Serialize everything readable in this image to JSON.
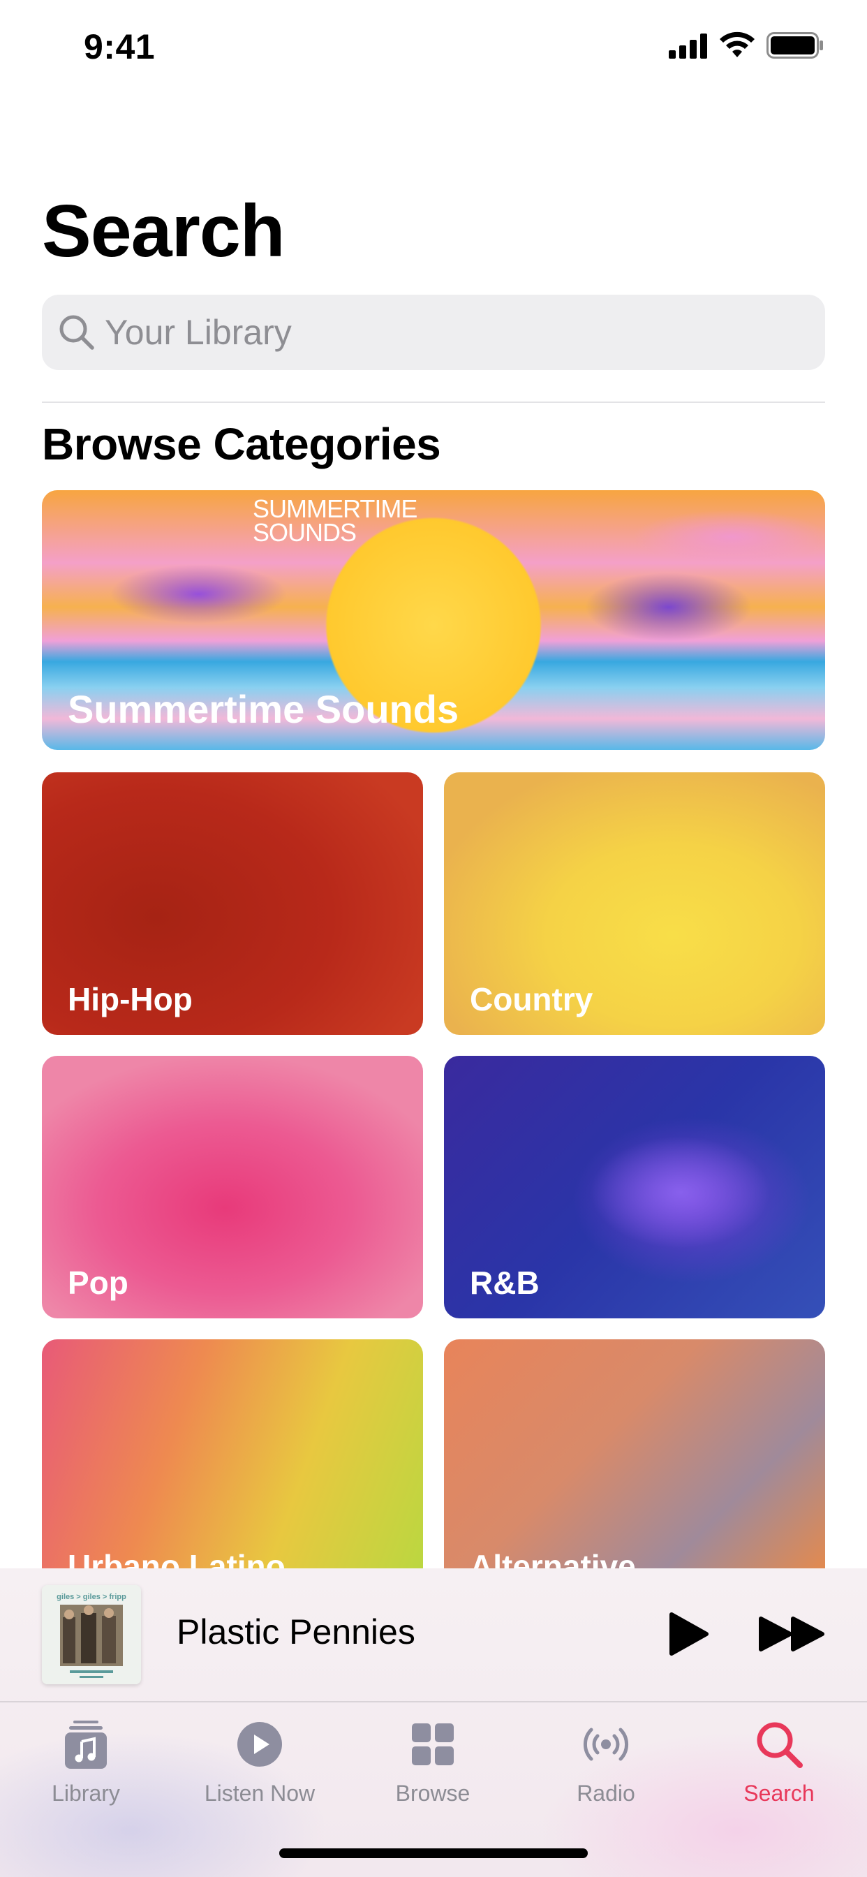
{
  "status_bar": {
    "time": "9:41"
  },
  "header": {
    "title": "Search"
  },
  "search": {
    "placeholder": "Your Library"
  },
  "browse": {
    "title": "Browse Categories",
    "featured": {
      "label": "Summertime Sounds",
      "logo_line1": "SUMMERTIME",
      "logo_line2": "SOUNDS"
    },
    "categories": [
      {
        "label": "Hip-Hop"
      },
      {
        "label": "Country"
      },
      {
        "label": "Pop"
      },
      {
        "label": "R&B"
      },
      {
        "label": "Urbano Latino"
      },
      {
        "label": "Alternative"
      }
    ]
  },
  "mini_player": {
    "track_title": "Plastic Pennies",
    "album_art_text": "giles > giles > fripp"
  },
  "tabs": [
    {
      "label": "Library",
      "icon": "library-icon"
    },
    {
      "label": "Listen Now",
      "icon": "listen-now-icon"
    },
    {
      "label": "Browse",
      "icon": "browse-icon"
    },
    {
      "label": "Radio",
      "icon": "radio-icon"
    },
    {
      "label": "Search",
      "icon": "search-icon",
      "active": true
    }
  ],
  "colors": {
    "accent": "#e8385a",
    "inactive": "#8c8c94"
  }
}
